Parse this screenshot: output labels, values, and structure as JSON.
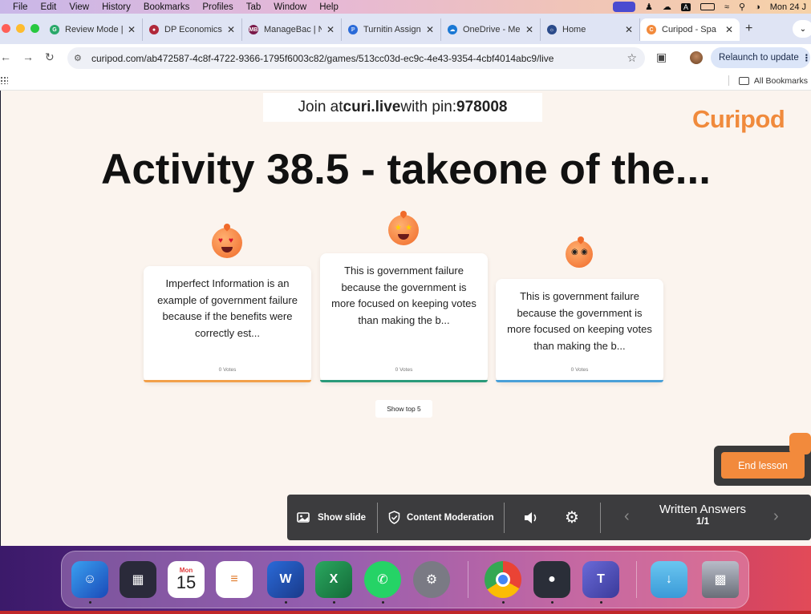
{
  "menubar": {
    "items": [
      "File",
      "Edit",
      "View",
      "History",
      "Bookmarks",
      "Profiles",
      "Tab",
      "Window",
      "Help"
    ],
    "clock": "Mon 24 J"
  },
  "tabs": [
    {
      "label": "Review Mode |",
      "favicon_color": "#2aa86a"
    },
    {
      "label": "DP Economics",
      "favicon_color": "#b0283a"
    },
    {
      "label": "ManageBac | N",
      "favicon_color": "#7a1a4a"
    },
    {
      "label": "Turnitin Assign",
      "favicon_color": "#2a6ad8"
    },
    {
      "label": "OneDrive - Me",
      "favicon_color": "#1a78d4"
    },
    {
      "label": "Home",
      "favicon_color": "#2a4a8a"
    },
    {
      "label": "Curipod - Spa",
      "favicon_color": "#f28a3c",
      "active": true
    }
  ],
  "addressbar": {
    "url": "curipod.com/ab472587-4c8f-4722-9366-1795f6003c82/games/513cc03d-ec9c-4e43-9354-4cbf4014abc9/live",
    "relaunch_label": "Relaunch to update"
  },
  "bookmarks": {
    "all_label": "All Bookmarks"
  },
  "page": {
    "join_prefix": "Join at ",
    "join_site": "curi.live",
    "join_mid": " with pin: ",
    "join_pin": "978008",
    "logo": "Curipod",
    "title": "Activity 38.5 - takeone of the...",
    "cards": [
      {
        "text": "Imperfect Information is an example of government failure because if the benefits were correctly est...",
        "votes": "0 Votes",
        "bar_color": "#f2a04a"
      },
      {
        "text": "This is government failure because the government is more focused on keeping votes than making the b...",
        "votes": "0 Votes",
        "bar_color": "#2a9a7a"
      },
      {
        "text": "This is government failure because the government is more focused on keeping votes than making the b...",
        "votes": "0 Votes",
        "bar_color": "#4aa0d8"
      }
    ],
    "show_top_label": "Show top 5",
    "end_lesson_label": "End lesson",
    "controls": {
      "show_slide": "Show slide",
      "content_moderation": "Content Moderation",
      "written_answers": "Written Answers",
      "counter": "1/1"
    }
  },
  "dock": {
    "calendar_month": "Mon",
    "calendar_day": "15"
  }
}
